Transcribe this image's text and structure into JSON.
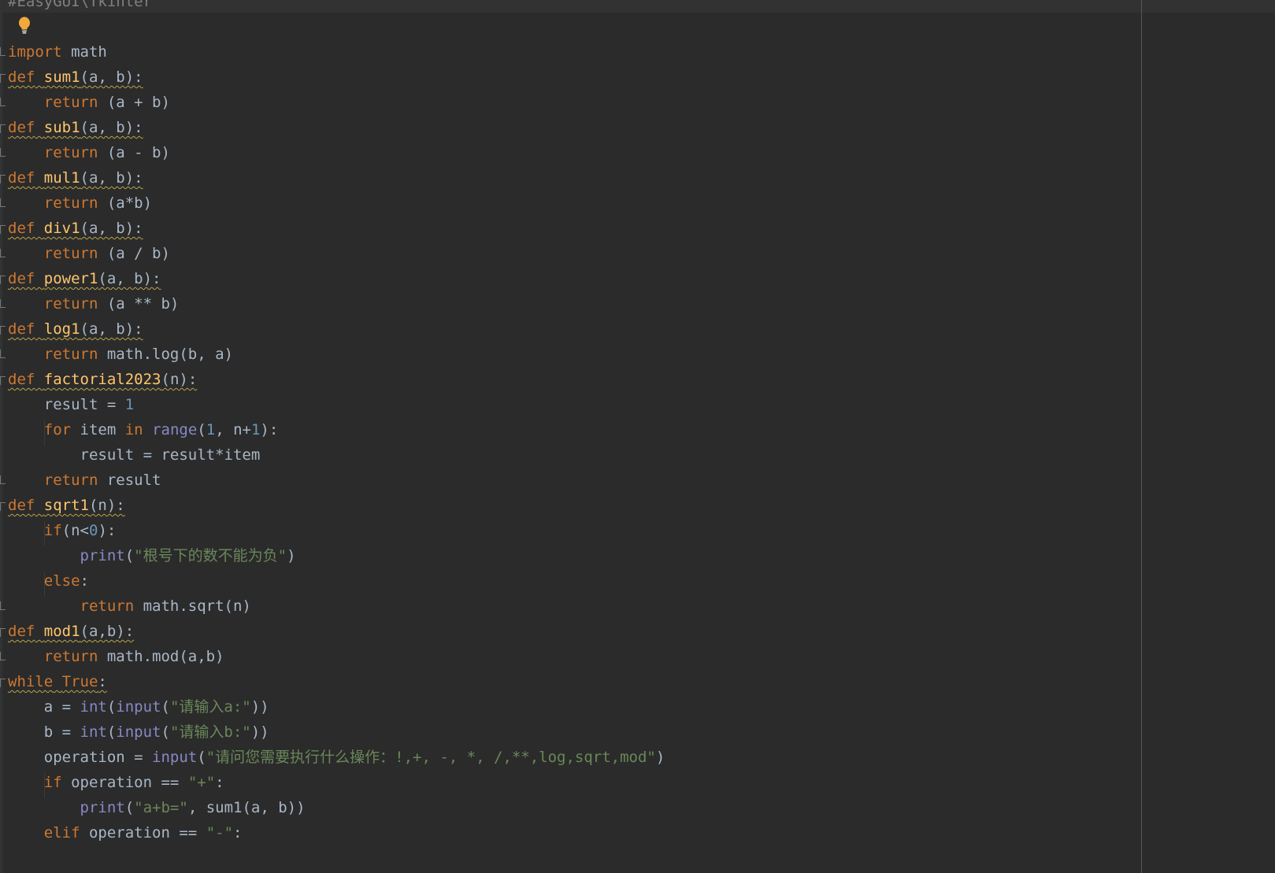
{
  "editor": {
    "header_comment": "#EasyGUI\\Tkinter",
    "lines": [
      [
        {
          "t": "import",
          "c": "kw"
        },
        {
          "t": " math",
          "c": "id"
        }
      ],
      [
        {
          "t": "def",
          "c": "kw"
        },
        {
          "t": " ",
          "c": "id"
        },
        {
          "t": "sum1",
          "c": "fn"
        },
        {
          "t": "(a, b):",
          "c": "id"
        }
      ],
      [
        {
          "t": "    ",
          "c": "id"
        },
        {
          "t": "return",
          "c": "kw"
        },
        {
          "t": " (a + b)",
          "c": "id"
        }
      ],
      [
        {
          "t": "def",
          "c": "kw"
        },
        {
          "t": " ",
          "c": "id"
        },
        {
          "t": "sub1",
          "c": "fn"
        },
        {
          "t": "(a, b):",
          "c": "id"
        }
      ],
      [
        {
          "t": "    ",
          "c": "id"
        },
        {
          "t": "return",
          "c": "kw"
        },
        {
          "t": " (a - b)",
          "c": "id"
        }
      ],
      [
        {
          "t": "def",
          "c": "kw"
        },
        {
          "t": " ",
          "c": "id"
        },
        {
          "t": "mul1",
          "c": "fn"
        },
        {
          "t": "(a, b):",
          "c": "id"
        }
      ],
      [
        {
          "t": "    ",
          "c": "id"
        },
        {
          "t": "return",
          "c": "kw"
        },
        {
          "t": " (a*b)",
          "c": "id"
        }
      ],
      [
        {
          "t": "def",
          "c": "kw"
        },
        {
          "t": " ",
          "c": "id"
        },
        {
          "t": "div1",
          "c": "fn"
        },
        {
          "t": "(a, b):",
          "c": "id"
        }
      ],
      [
        {
          "t": "    ",
          "c": "id"
        },
        {
          "t": "return",
          "c": "kw"
        },
        {
          "t": " (a / b)",
          "c": "id"
        }
      ],
      [
        {
          "t": "def",
          "c": "kw"
        },
        {
          "t": " ",
          "c": "id"
        },
        {
          "t": "power1",
          "c": "fn"
        },
        {
          "t": "(a, b):",
          "c": "id"
        }
      ],
      [
        {
          "t": "    ",
          "c": "id"
        },
        {
          "t": "return",
          "c": "kw"
        },
        {
          "t": " (a ** b)",
          "c": "id"
        }
      ],
      [
        {
          "t": "def",
          "c": "kw"
        },
        {
          "t": " ",
          "c": "id"
        },
        {
          "t": "log1",
          "c": "fn"
        },
        {
          "t": "(a, b):",
          "c": "id"
        }
      ],
      [
        {
          "t": "    ",
          "c": "id"
        },
        {
          "t": "return",
          "c": "kw"
        },
        {
          "t": " math.log(b, a)",
          "c": "id"
        }
      ],
      [
        {
          "t": "def",
          "c": "kw"
        },
        {
          "t": " ",
          "c": "id"
        },
        {
          "t": "factorial2023",
          "c": "fn"
        },
        {
          "t": "(n):",
          "c": "id"
        }
      ],
      [
        {
          "t": "    result = ",
          "c": "id"
        },
        {
          "t": "1",
          "c": "num"
        }
      ],
      [
        {
          "t": "    ",
          "c": "id"
        },
        {
          "t": "for",
          "c": "kw"
        },
        {
          "t": " item ",
          "c": "id"
        },
        {
          "t": "in",
          "c": "kw"
        },
        {
          "t": " ",
          "c": "id"
        },
        {
          "t": "range",
          "c": "bi"
        },
        {
          "t": "(",
          "c": "id"
        },
        {
          "t": "1",
          "c": "num"
        },
        {
          "t": ", n+",
          "c": "id"
        },
        {
          "t": "1",
          "c": "num"
        },
        {
          "t": "):",
          "c": "id"
        }
      ],
      [
        {
          "t": "        result = result*item",
          "c": "id"
        }
      ],
      [
        {
          "t": "    ",
          "c": "id"
        },
        {
          "t": "return",
          "c": "kw"
        },
        {
          "t": " result",
          "c": "id"
        }
      ],
      [
        {
          "t": "def",
          "c": "kw"
        },
        {
          "t": " ",
          "c": "id"
        },
        {
          "t": "sqrt1",
          "c": "fn"
        },
        {
          "t": "(n):",
          "c": "id"
        }
      ],
      [
        {
          "t": "    ",
          "c": "id"
        },
        {
          "t": "if",
          "c": "kw"
        },
        {
          "t": "(n<",
          "c": "id"
        },
        {
          "t": "0",
          "c": "num"
        },
        {
          "t": "):",
          "c": "id"
        }
      ],
      [
        {
          "t": "        ",
          "c": "id"
        },
        {
          "t": "print",
          "c": "bi"
        },
        {
          "t": "(",
          "c": "id"
        },
        {
          "t": "\"根号下的数不能为负\"",
          "c": "str"
        },
        {
          "t": ")",
          "c": "id"
        }
      ],
      [
        {
          "t": "    ",
          "c": "id"
        },
        {
          "t": "else",
          "c": "kw"
        },
        {
          "t": ":",
          "c": "id"
        }
      ],
      [
        {
          "t": "        ",
          "c": "id"
        },
        {
          "t": "return",
          "c": "kw"
        },
        {
          "t": " math.sqrt(n)",
          "c": "id"
        }
      ],
      [
        {
          "t": "def",
          "c": "kw"
        },
        {
          "t": " ",
          "c": "id"
        },
        {
          "t": "mod1",
          "c": "fn"
        },
        {
          "t": "(a,b):",
          "c": "id"
        }
      ],
      [
        {
          "t": "    ",
          "c": "id"
        },
        {
          "t": "return",
          "c": "kw"
        },
        {
          "t": " math.mod(a,b)",
          "c": "id"
        }
      ],
      [
        {
          "t": "while",
          "c": "kw"
        },
        {
          "t": " ",
          "c": "id"
        },
        {
          "t": "True",
          "c": "kw"
        },
        {
          "t": ":",
          "c": "id"
        }
      ],
      [
        {
          "t": "    a = ",
          "c": "id"
        },
        {
          "t": "int",
          "c": "bi"
        },
        {
          "t": "(",
          "c": "id"
        },
        {
          "t": "input",
          "c": "bi"
        },
        {
          "t": "(",
          "c": "id"
        },
        {
          "t": "\"请输入a:\"",
          "c": "str"
        },
        {
          "t": "))",
          "c": "id"
        }
      ],
      [
        {
          "t": "    b = ",
          "c": "id"
        },
        {
          "t": "int",
          "c": "bi"
        },
        {
          "t": "(",
          "c": "id"
        },
        {
          "t": "input",
          "c": "bi"
        },
        {
          "t": "(",
          "c": "id"
        },
        {
          "t": "\"请输入b:\"",
          "c": "str"
        },
        {
          "t": "))",
          "c": "id"
        }
      ],
      [
        {
          "t": "    operation = ",
          "c": "id"
        },
        {
          "t": "input",
          "c": "bi"
        },
        {
          "t": "(",
          "c": "id"
        },
        {
          "t": "\"请问您需要执行什么操作：!,+, -, *, /,**,log,sqrt,mod\"",
          "c": "str"
        },
        {
          "t": ")",
          "c": "id"
        }
      ],
      [
        {
          "t": "    ",
          "c": "id"
        },
        {
          "t": "if",
          "c": "kw"
        },
        {
          "t": " operation == ",
          "c": "id"
        },
        {
          "t": "\"+\"",
          "c": "str"
        },
        {
          "t": ":",
          "c": "id"
        }
      ],
      [
        {
          "t": "        ",
          "c": "id"
        },
        {
          "t": "print",
          "c": "bi"
        },
        {
          "t": "(",
          "c": "id"
        },
        {
          "t": "\"a+b=\"",
          "c": "str"
        },
        {
          "t": ", sum1(a, b))",
          "c": "id"
        }
      ],
      [
        {
          "t": "    ",
          "c": "id"
        },
        {
          "t": "elif",
          "c": "kw"
        },
        {
          "t": " operation == ",
          "c": "id"
        },
        {
          "t": "\"-\"",
          "c": "str"
        },
        {
          "t": ":",
          "c": "id"
        }
      ]
    ]
  },
  "colors": {
    "background": "#2b2b2b",
    "keyword": "#cc7832",
    "function": "#ffc66d",
    "builtin": "#8888c6",
    "number": "#6897bb",
    "string": "#6a8759",
    "text": "#a9b7c6",
    "bulb": "#f2a93b"
  },
  "icons": {
    "intention": "lightbulb-icon"
  }
}
